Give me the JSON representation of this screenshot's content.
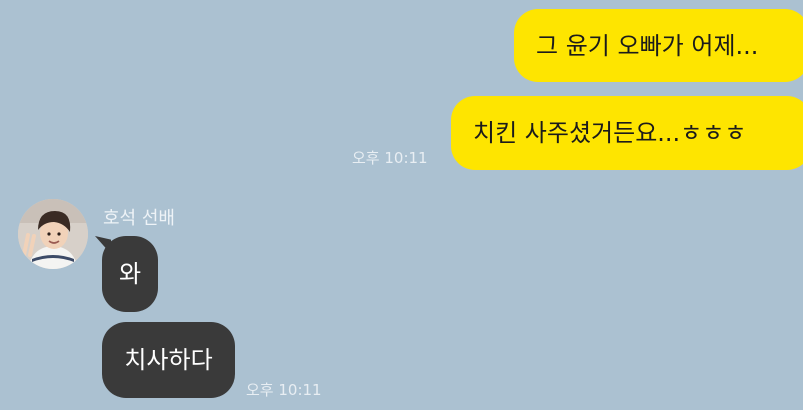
{
  "chat": {
    "messages": [
      {
        "sender": "me",
        "text": "그 윤기 오빠가 어제..."
      },
      {
        "sender": "me",
        "text": "치킨 사주셨거든요...ㅎㅎㅎ",
        "time": "오후 10:11"
      },
      {
        "sender": "other",
        "text": "와"
      },
      {
        "sender": "other",
        "text": "치사하다",
        "time": "오후 10:11"
      }
    ],
    "other_user": {
      "name": "호석 선배"
    }
  },
  "colors": {
    "background": "#abc1d1",
    "my_bubble": "#fee500",
    "other_bubble": "#3a3a3a",
    "timestamp": "#e8eef3"
  }
}
